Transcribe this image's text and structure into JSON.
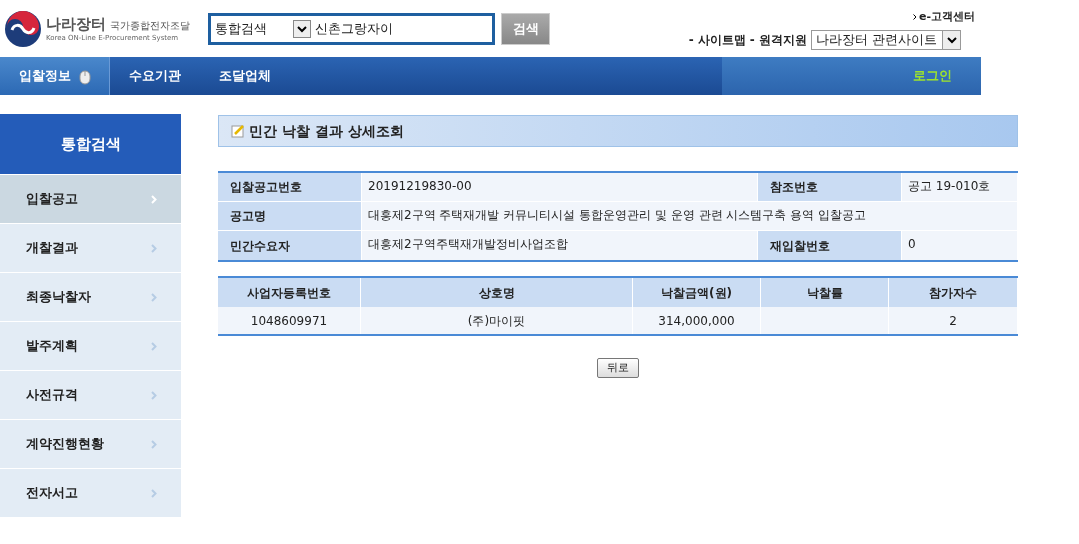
{
  "header": {
    "logo": {
      "name": "나라장터",
      "subtitle": "국가종합전자조달",
      "english": "Korea ON-Line E-Procurement System"
    },
    "search": {
      "category": "통합검색",
      "value": "신촌그랑자이",
      "button": "검색"
    },
    "customer_center": "e-고객센터",
    "links": [
      "- 사이트맵",
      "- 원격지원"
    ],
    "related_sites": "나라장터 관련사이트"
  },
  "nav": {
    "items": [
      {
        "label": "입찰정보",
        "selected": true
      },
      {
        "label": "수요기관",
        "selected": false
      },
      {
        "label": "조달업체",
        "selected": false
      }
    ],
    "login": "로그인"
  },
  "sidebar": {
    "title": "통합검색",
    "items": [
      {
        "label": "입찰공고",
        "selected": true
      },
      {
        "label": "개찰결과",
        "selected": false
      },
      {
        "label": "최종낙찰자",
        "selected": false
      },
      {
        "label": "발주계획",
        "selected": false
      },
      {
        "label": "사전규격",
        "selected": false
      },
      {
        "label": "계약진행현황",
        "selected": false
      },
      {
        "label": "전자서고",
        "selected": false
      }
    ]
  },
  "page_title": "민간 낙찰 결과 상세조회",
  "info_table": {
    "rows": [
      [
        {
          "label": "입찰공고번호",
          "value": "20191219830-00"
        },
        {
          "label": "참조번호",
          "value": "공고 19-010호"
        }
      ],
      [
        {
          "label": "공고명",
          "value": "대흥제2구역 주택재개발 커뮤니티시설 통합운영관리 및 운영 관련 시스템구축 용역 입찰공고"
        }
      ],
      [
        {
          "label": "민간수요자",
          "value": "대흥제2구역주택재개발정비사업조합"
        },
        {
          "label": "재입찰번호",
          "value": "0"
        }
      ]
    ]
  },
  "result_table": {
    "columns": [
      "사업자등록번호",
      "상호명",
      "낙찰금액(원)",
      "낙찰률",
      "참가자수"
    ],
    "rows": [
      [
        "1048609971",
        "(주)마이핏",
        "314,000,000",
        "",
        "2"
      ]
    ]
  },
  "back_button": "뒤로"
}
